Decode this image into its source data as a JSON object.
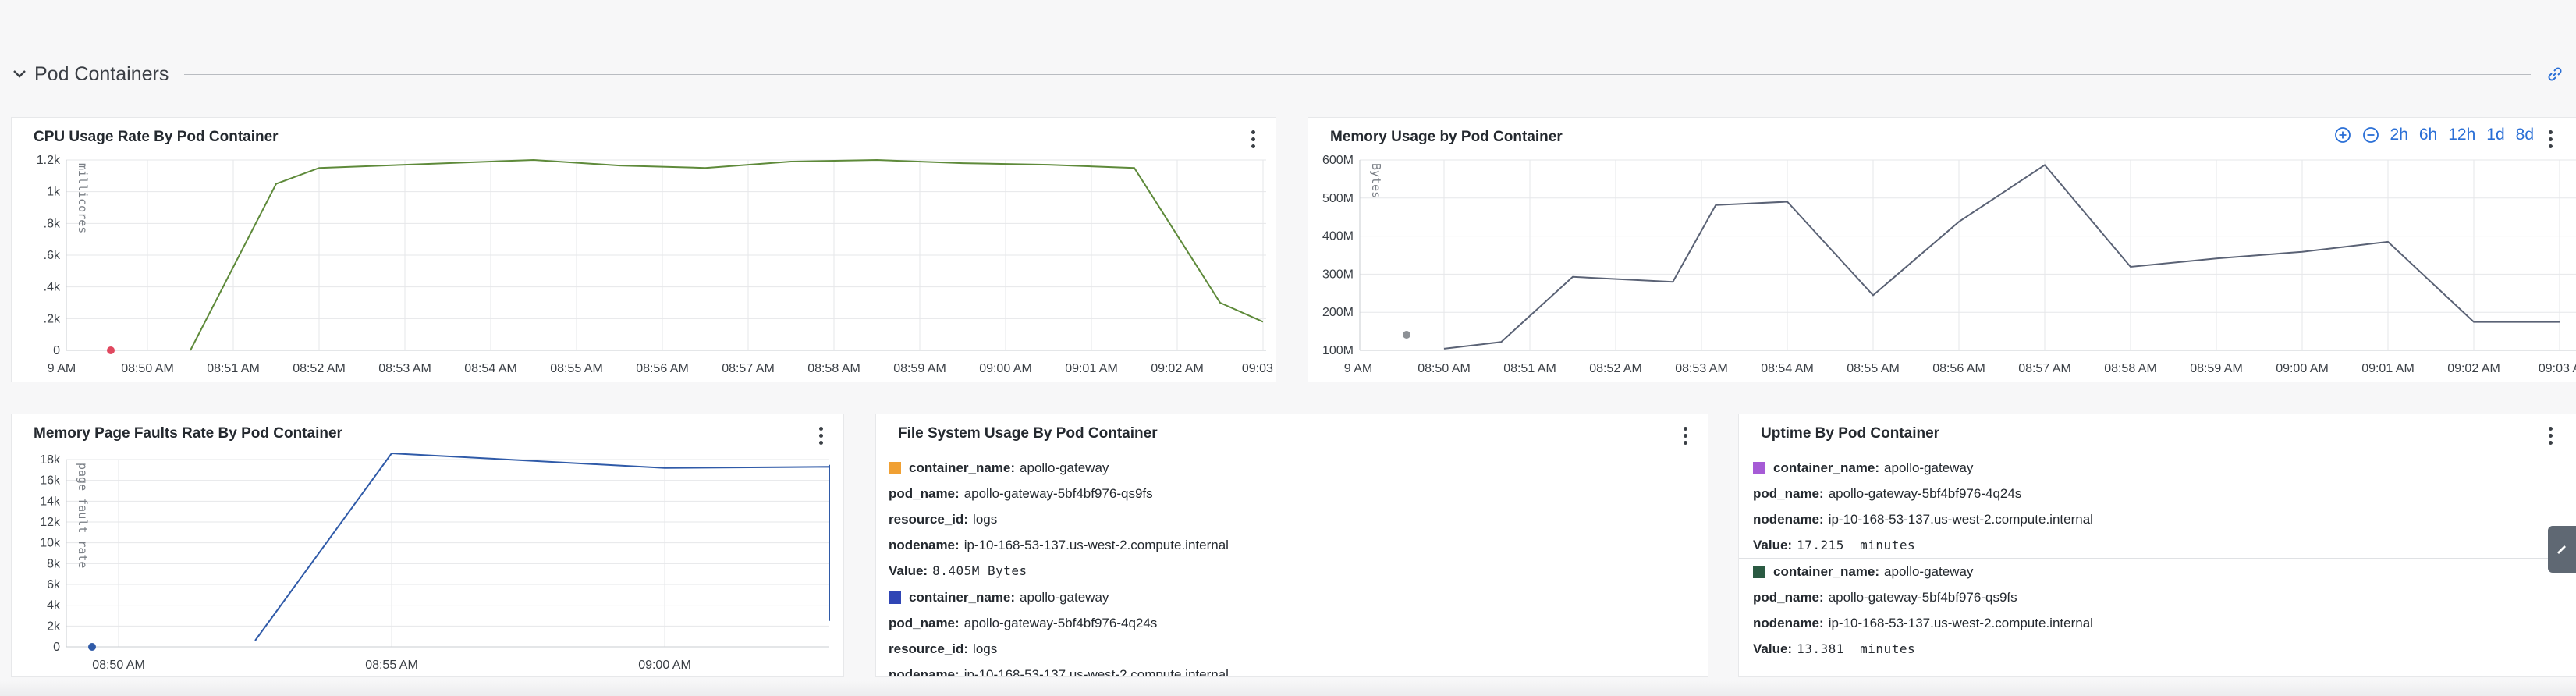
{
  "section": {
    "title": "Pod Containers"
  },
  "cpu_panel": {
    "title": "CPU Usage Rate By Pod Container",
    "ylabel": "millicores",
    "yticks": [
      "1.2k",
      "1k",
      ".8k",
      ".6k",
      ".4k",
      ".2k",
      "0"
    ],
    "xticks": [
      "9 AM",
      "08:50 AM",
      "08:51 AM",
      "08:52 AM",
      "08:53 AM",
      "08:54 AM",
      "08:55 AM",
      "08:56 AM",
      "08:57 AM",
      "08:58 AM",
      "08:59 AM",
      "09:00 AM",
      "09:01 AM",
      "09:02 AM",
      "09:03 A"
    ],
    "color": "#5e8a3a"
  },
  "memory_panel": {
    "title": "Memory Usage by Pod Container",
    "ylabel": "Bytes",
    "yticks": [
      "600M",
      "500M",
      "400M",
      "300M",
      "200M",
      "100M"
    ],
    "xticks": [
      "9 AM",
      "08:50 AM",
      "08:51 AM",
      "08:52 AM",
      "08:53 AM",
      "08:54 AM",
      "08:55 AM",
      "08:56 AM",
      "08:57 AM",
      "08:58 AM",
      "08:59 AM",
      "09:00 AM",
      "09:01 AM",
      "09:02 AM",
      "09:03 A"
    ],
    "toolbar": [
      "2h",
      "6h",
      "12h",
      "1d",
      "8d"
    ],
    "color": "#5a6275"
  },
  "faults_panel": {
    "title": "Memory Page Faults Rate By Pod Container",
    "ylabel": "page fault rate",
    "yticks": [
      "18k",
      "16k",
      "14k",
      "12k",
      "10k",
      "8k",
      "6k",
      "4k",
      "2k",
      "0"
    ],
    "xticks": [
      "08:50 AM",
      "08:55 AM",
      "09:00 AM"
    ],
    "color": "#2f5aa8"
  },
  "fs_panel": {
    "title": "File System Usage By Pod Container",
    "entries": [
      {
        "color": "#f0a033",
        "container_key": "container_name:",
        "container": "apollo-gateway",
        "pod_key": "pod_name:",
        "pod": "apollo-gateway-5bf4bf976-qs9fs",
        "resource_key": "resource_id:",
        "resource": "logs",
        "node_key": "nodename:",
        "node": "ip-10-168-53-137.us-west-2.compute.internal",
        "value_key": "Value:",
        "value": "8.405M Bytes"
      },
      {
        "color": "#2f45b5",
        "container_key": "container_name:",
        "container": "apollo-gateway",
        "pod_key": "pod_name:",
        "pod": "apollo-gateway-5bf4bf976-4q24s",
        "resource_key": "resource_id:",
        "resource": "logs",
        "node_key": "nodename:",
        "node": "ip-10-168-53-137.us-west-2.compute.internal"
      }
    ]
  },
  "uptime_panel": {
    "title": "Uptime By Pod Container",
    "entries": [
      {
        "color": "#a65bd6",
        "container_key": "container_name:",
        "container": "apollo-gateway",
        "pod_key": "pod_name:",
        "pod": "apollo-gateway-5bf4bf976-4q24s",
        "node_key": "nodename:",
        "node": "ip-10-168-53-137.us-west-2.compute.internal",
        "value_key": "Value:",
        "value": "17.215  minutes"
      },
      {
        "color": "#2a5a42",
        "container_key": "container_name:",
        "container": "apollo-gateway",
        "pod_key": "pod_name:",
        "pod": "apollo-gateway-5bf4bf976-qs9fs",
        "node_key": "nodename:",
        "node": "ip-10-168-53-137.us-west-2.compute.internal",
        "value_key": "Value:",
        "value": "13.381  minutes"
      }
    ]
  },
  "chart_data": [
    {
      "type": "line",
      "title": "CPU Usage Rate By Pod Container",
      "ylabel": "millicores",
      "xlabel": "",
      "ylim": [
        0,
        1200
      ],
      "x": [
        "08:50:30",
        "08:51:30",
        "08:52:00",
        "08:53:00",
        "08:54:30",
        "08:55:30",
        "08:56:30",
        "08:57:30",
        "08:58:30",
        "08:59:30",
        "09:00:30",
        "09:01:30",
        "09:02:30",
        "09:03:00"
      ],
      "series": [
        {
          "values": [
            0,
            1050,
            1150,
            1170,
            1200,
            1165,
            1150,
            1190,
            1200,
            1180,
            1170,
            1150,
            300,
            180
          ],
          "color": "#5e8a3a"
        }
      ]
    },
    {
      "type": "line",
      "title": "Memory Usage by Pod Container",
      "ylabel": "Bytes",
      "xlabel": "",
      "ylim": [
        50,
        620
      ],
      "x": [
        "08:50:00",
        "08:50:40",
        "08:51:30",
        "08:52:40",
        "08:53:10",
        "08:54:00",
        "08:55:00",
        "08:56:00",
        "08:57:00",
        "08:58:00",
        "08:59:00",
        "09:00:00",
        "09:01:00",
        "09:02:00",
        "09:03:00"
      ],
      "series": [
        {
          "values": [
            55,
            75,
            270,
            255,
            485,
            495,
            215,
            435,
            605,
            300,
            325,
            345,
            375,
            135,
            135
          ],
          "color": "#5a6275"
        }
      ]
    },
    {
      "type": "line",
      "title": "Memory Page Faults Rate By Pod Container",
      "ylabel": "page fault rate",
      "xlabel": "",
      "ylim": [
        0,
        18000
      ],
      "x": [
        "08:50:30",
        "08:51:00",
        "08:52:00",
        "08:53:00",
        "08:54:00",
        "08:55:00",
        "08:56:00",
        "08:57:00",
        "08:58:00",
        "08:59:00",
        "09:00:00",
        "09:01:00",
        "09:02:00",
        "09:03:00",
        "09:03:30"
      ],
      "series": [
        {
          "values": [
            600,
            18600,
            17200,
            17300,
            16900,
            17300,
            17100,
            17300,
            17200,
            17000,
            17500,
            17200,
            4600,
            2500
          ],
          "color": "#2f5aa8"
        }
      ]
    }
  ]
}
